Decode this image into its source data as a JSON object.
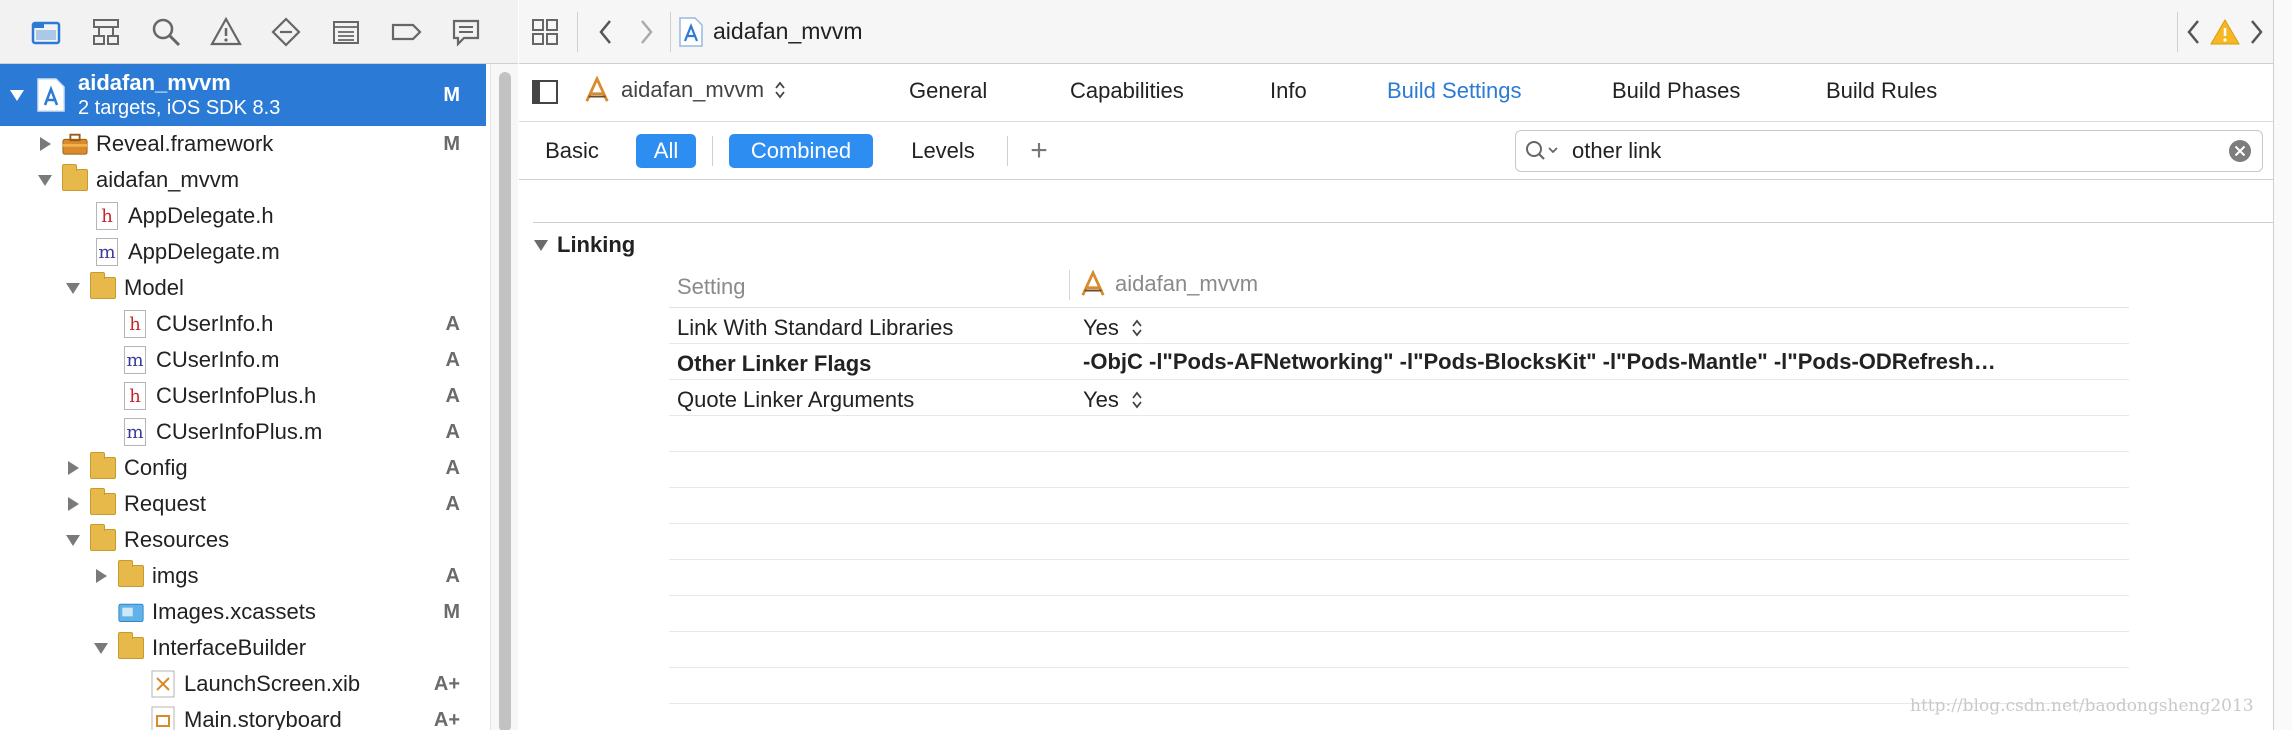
{
  "navigator": {
    "toolbar_icons": [
      "folder-icon",
      "hierarchy-icon",
      "search-icon",
      "warning-icon",
      "diamond-icon",
      "list-icon",
      "tag-icon",
      "speech-bubble-icon"
    ],
    "project": {
      "name": "aidafan_mvvm",
      "subtitle": "2 targets, iOS SDK 8.3",
      "badge": "M"
    },
    "items": [
      {
        "label": "Reveal.framework",
        "badge": "M",
        "icon": "toolbox-icon"
      },
      {
        "label": "aidafan_mvvm",
        "badge": "",
        "icon": "folder-icon"
      },
      {
        "label": "AppDelegate.h",
        "badge": "",
        "icon": "header-file-icon",
        "glyph": "h"
      },
      {
        "label": "AppDelegate.m",
        "badge": "",
        "icon": "implementation-file-icon",
        "glyph": "m"
      },
      {
        "label": "Model",
        "badge": "",
        "icon": "folder-icon"
      },
      {
        "label": "CUserInfo.h",
        "badge": "A",
        "icon": "header-file-icon",
        "glyph": "h"
      },
      {
        "label": "CUserInfo.m",
        "badge": "A",
        "icon": "implementation-file-icon",
        "glyph": "m"
      },
      {
        "label": "CUserInfoPlus.h",
        "badge": "A",
        "icon": "header-file-icon",
        "glyph": "h"
      },
      {
        "label": "CUserInfoPlus.m",
        "badge": "A",
        "icon": "implementation-file-icon",
        "glyph": "m"
      },
      {
        "label": "Config",
        "badge": "A",
        "icon": "folder-icon"
      },
      {
        "label": "Request",
        "badge": "A",
        "icon": "folder-icon"
      },
      {
        "label": "Resources",
        "badge": "",
        "icon": "folder-icon"
      },
      {
        "label": "imgs",
        "badge": "A",
        "icon": "folder-icon"
      },
      {
        "label": "Images.xcassets",
        "badge": "M",
        "icon": "asset-catalog-icon"
      },
      {
        "label": "InterfaceBuilder",
        "badge": "",
        "icon": "folder-icon"
      },
      {
        "label": "LaunchScreen.xib",
        "badge": "A+",
        "icon": "xib-file-icon"
      },
      {
        "label": "Main.storyboard",
        "badge": "A+",
        "icon": "storyboard-file-icon"
      }
    ]
  },
  "jumpbar": {
    "file_name": "aidafan_mvvm"
  },
  "tabs": {
    "target": "aidafan_mvvm",
    "items": [
      "General",
      "Capabilities",
      "Info",
      "Build Settings",
      "Build Phases",
      "Build Rules"
    ],
    "active": "Build Settings"
  },
  "filter": {
    "basic": "Basic",
    "all": "All",
    "combined": "Combined",
    "levels": "Levels",
    "add": "+",
    "search_value": "other link"
  },
  "settings": {
    "section": "Linking",
    "header_setting": "Setting",
    "header_target": "aidafan_mvvm",
    "rows": [
      {
        "name": "Link With Standard Libraries",
        "value": "Yes",
        "stepper": true,
        "bold": false
      },
      {
        "name": "Other Linker Flags",
        "value": "-ObjC -l\"Pods-AFNetworking\" -l\"Pods-BlocksKit\" -l\"Pods-Mantle\" -l\"Pods-ODRefresh…",
        "stepper": false,
        "bold": true
      },
      {
        "name": "Quote Linker Arguments",
        "value": "Yes",
        "stepper": true,
        "bold": false
      }
    ]
  },
  "watermark": "http://blog.csdn.net/baodongsheng2013",
  "colors": {
    "accent": "#2b7bd6",
    "selection": "#2e8df0",
    "folder": "#e7b94a"
  }
}
